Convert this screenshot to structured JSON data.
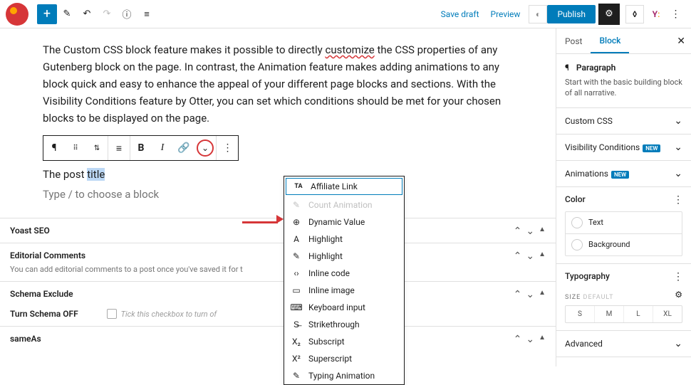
{
  "topbar": {
    "save_draft": "Save draft",
    "preview": "Preview",
    "publish": "Publish"
  },
  "content": {
    "paragraph_pre": "The Custom CSS block feature makes it possible to directly ",
    "paragraph_link": "customize",
    "paragraph_post": " the CSS properties of any Gutenberg block on the page. In contrast, the Animation feature makes adding animations to any block quick and easy to enhance the appeal of your different page blocks and sections. With the Visibility Conditions feature by Otter, you can set which conditions should be met for your chosen blocks to be displayed on the page.",
    "post_pre": "The post ",
    "post_sel": "title",
    "placeholder": "Type / to choose a block"
  },
  "dropdown": {
    "items": [
      {
        "icon": "TA",
        "label": "Affiliate Link",
        "hl": true
      },
      {
        "icon": "✎",
        "label": "Count Animation",
        "dis": true
      },
      {
        "icon": "⊕",
        "label": "Dynamic Value"
      },
      {
        "icon": "A",
        "label": "Highlight"
      },
      {
        "icon": "✎",
        "label": "Highlight"
      },
      {
        "icon": "‹›",
        "label": "Inline code"
      },
      {
        "icon": "▭",
        "label": "Inline image"
      },
      {
        "icon": "⌨",
        "label": "Keyboard input"
      },
      {
        "icon": "S̶",
        "label": "Strikethrough"
      },
      {
        "icon": "X₂",
        "label": "Subscript"
      },
      {
        "icon": "X²",
        "label": "Superscript"
      },
      {
        "icon": "✎",
        "label": "Typing Animation"
      }
    ]
  },
  "meta": {
    "yoast": "Yoast SEO",
    "editorial": "Editorial Comments",
    "editorial_sub": "You can add editorial comments to a post once you've saved it for t",
    "schema_exclude": "Schema Exclude",
    "turn_schema_off": "Turn Schema OFF",
    "schema_tick": "Tick this checkbox to turn of",
    "sameas": "sameAs"
  },
  "sidebar": {
    "tabs": {
      "post": "Post",
      "block": "Block"
    },
    "block_head": {
      "title": "Paragraph",
      "desc": "Start with the basic building block of all narrative."
    },
    "accordion": {
      "custom_css": "Custom CSS",
      "visibility": "Visibility Conditions",
      "animations": "Animations",
      "new": "NEW",
      "advanced": "Advanced"
    },
    "color": {
      "title": "Color",
      "text": "Text",
      "background": "Background"
    },
    "typo": {
      "title": "Typography",
      "size_label": "SIZE",
      "size_default": "DEFAULT",
      "sizes": [
        "S",
        "M",
        "L",
        "XL"
      ]
    }
  }
}
